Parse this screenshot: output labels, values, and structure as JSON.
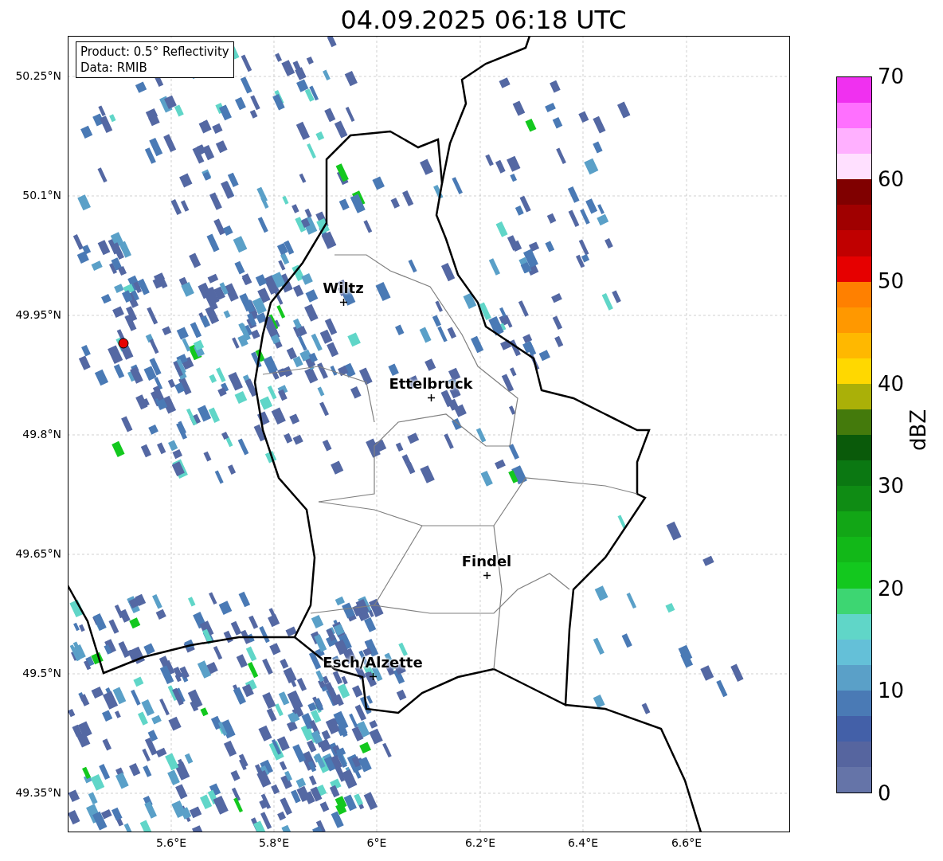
{
  "title": "04.09.2025 06:18 UTC",
  "info_box": {
    "lines": [
      "Product: 0.5° Reflectivity",
      "Data: RMIB"
    ]
  },
  "map": {
    "places": [
      {
        "name": "Wiltz"
      },
      {
        "name": "Ettelbruck"
      },
      {
        "name": "Findel"
      },
      {
        "name": "Esch/Alzette"
      }
    ],
    "y_ticks": [
      "50.25°N",
      "50.1°N",
      "49.95°N",
      "49.8°N",
      "49.65°N",
      "49.5°N",
      "49.35°N"
    ],
    "x_ticks": [
      "5.6°E",
      "5.8°E",
      "6°E",
      "6.2°E",
      "6.4°E",
      "6.6°E"
    ]
  },
  "colorbar": {
    "label": "dBZ",
    "ticks": [
      "70",
      "60",
      "50",
      "40",
      "30",
      "20",
      "10",
      "0"
    ],
    "segments": [
      {
        "color": "#f030f0"
      },
      {
        "color": "#ff70ff"
      },
      {
        "color": "#ffb0ff"
      },
      {
        "color": "#ffe0ff"
      },
      {
        "color": "#800000"
      },
      {
        "color": "#a00000"
      },
      {
        "color": "#c00000"
      },
      {
        "color": "#e60000"
      },
      {
        "color": "#ff8000"
      },
      {
        "color": "#ff9800"
      },
      {
        "color": "#ffb800"
      },
      {
        "color": "#ffd800"
      },
      {
        "color": "#aab008"
      },
      {
        "color": "#447a0c"
      },
      {
        "color": "#0a5a0a"
      },
      {
        "color": "#0b7812"
      },
      {
        "color": "#0f8c14"
      },
      {
        "color": "#12a616"
      },
      {
        "color": "#12b818"
      },
      {
        "color": "#13c81e"
      },
      {
        "color": "#3dd672"
      },
      {
        "color": "#60d6c8"
      },
      {
        "color": "#64c0d8"
      },
      {
        "color": "#5aa0c8"
      },
      {
        "color": "#4a7ab5"
      },
      {
        "color": "#4360a8"
      },
      {
        "color": "#56659f"
      },
      {
        "color": "#6574a8"
      }
    ]
  }
}
